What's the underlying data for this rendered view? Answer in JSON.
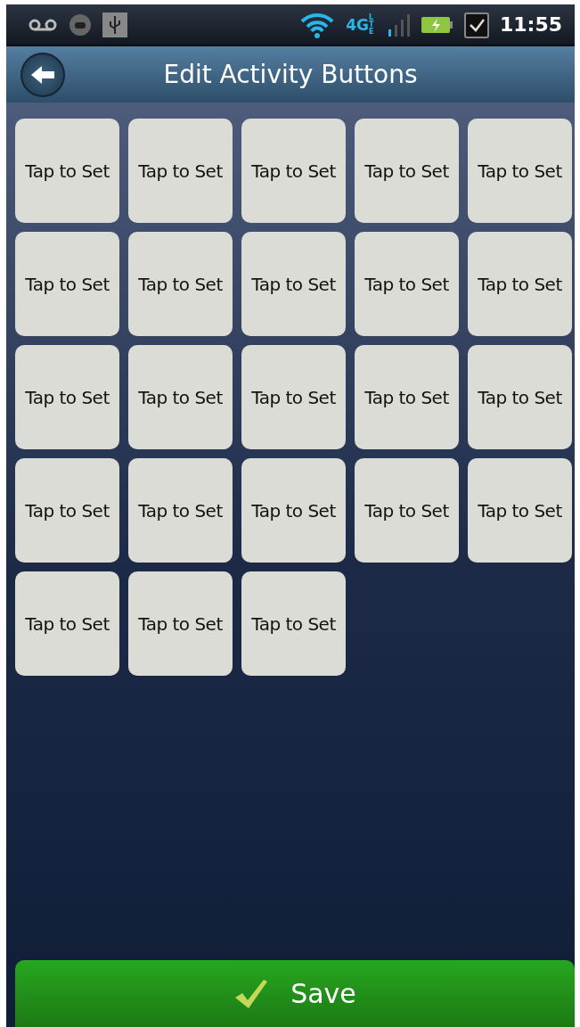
{
  "status_bar": {
    "network": "4G",
    "network_badge": "LTE",
    "time": "11:55"
  },
  "header": {
    "title": "Edit Activity Buttons"
  },
  "buttons": [
    {
      "label": "Tap to Set"
    },
    {
      "label": "Tap to Set"
    },
    {
      "label": "Tap to Set"
    },
    {
      "label": "Tap to Set"
    },
    {
      "label": "Tap to Set"
    },
    {
      "label": "Tap to Set"
    },
    {
      "label": "Tap to Set"
    },
    {
      "label": "Tap to Set"
    },
    {
      "label": "Tap to Set"
    },
    {
      "label": "Tap to Set"
    },
    {
      "label": "Tap to Set"
    },
    {
      "label": "Tap to Set"
    },
    {
      "label": "Tap to Set"
    },
    {
      "label": "Tap to Set"
    },
    {
      "label": "Tap to Set"
    },
    {
      "label": "Tap to Set"
    },
    {
      "label": "Tap to Set"
    },
    {
      "label": "Tap to Set"
    },
    {
      "label": "Tap to Set"
    },
    {
      "label": "Tap to Set"
    },
    {
      "label": "Tap to Set"
    },
    {
      "label": "Tap to Set"
    },
    {
      "label": "Tap to Set"
    }
  ],
  "save_button": {
    "label": "Save"
  }
}
